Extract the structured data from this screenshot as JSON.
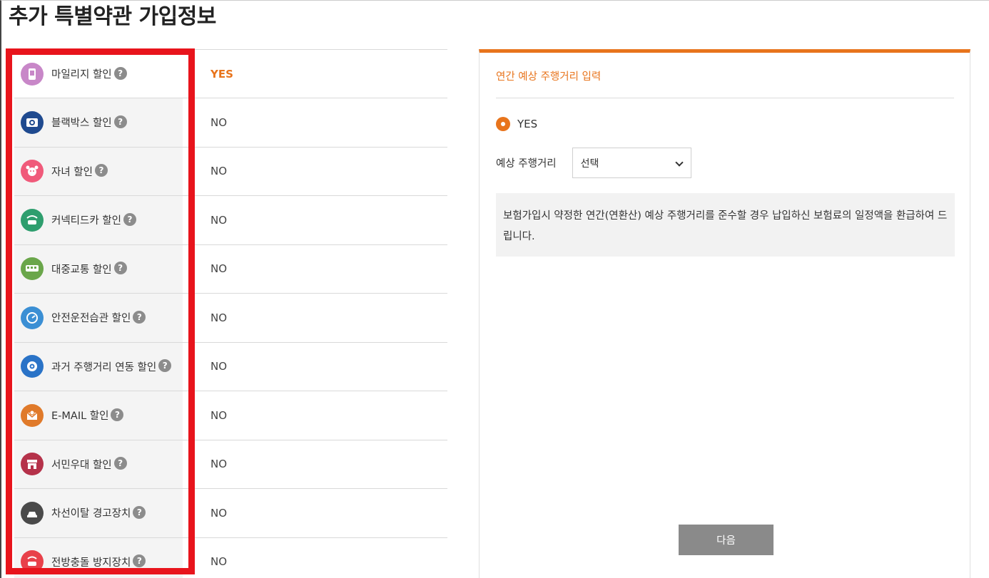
{
  "page": {
    "title": "추가 특별약관 가입정보"
  },
  "discounts": [
    {
      "name": "mileage",
      "label": "마일리지 할인",
      "value": "YES",
      "icon": "mileage-phone-icon",
      "color": "#c887c8"
    },
    {
      "name": "blackbox",
      "label": "블랙박스 할인",
      "value": "NO",
      "icon": "blackbox-camera-icon",
      "color": "#1f4a8f"
    },
    {
      "name": "child",
      "label": "자녀 할인",
      "value": "NO",
      "icon": "child-face-icon",
      "color": "#f05a7a"
    },
    {
      "name": "connected-car",
      "label": "커넥티드카 할인",
      "value": "NO",
      "icon": "connected-car-icon",
      "color": "#2e9e6e"
    },
    {
      "name": "public-transit",
      "label": "대중교통 할인",
      "value": "NO",
      "icon": "bus-icon",
      "color": "#6aa64a"
    },
    {
      "name": "safe-driving",
      "label": "안전운전습관 할인",
      "value": "NO",
      "icon": "speedometer-icon",
      "color": "#3b8fd4"
    },
    {
      "name": "past-mileage",
      "label": "과거 주행거리 연동 할인",
      "value": "NO",
      "icon": "odometer-icon",
      "color": "#2a73c7"
    },
    {
      "name": "email",
      "label": "E-MAIL 할인",
      "value": "NO",
      "icon": "envelope-icon",
      "color": "#e07a2a"
    },
    {
      "name": "low-income",
      "label": "서민우대 할인",
      "value": "NO",
      "icon": "store-icon",
      "color": "#b5324a"
    },
    {
      "name": "lane-warning",
      "label": "차선이탈 경고장치",
      "value": "NO",
      "icon": "car-lane-icon",
      "color": "#4a4a4a"
    },
    {
      "name": "collision",
      "label": "전방충돌 방지장치",
      "value": "NO",
      "icon": "car-collision-icon",
      "color": "#e8414a"
    }
  ],
  "help_symbol": "?",
  "panel": {
    "title": "연간 예상 주행거리 입력",
    "radio_label": "YES",
    "select_label": "예상 주행거리",
    "select_value": "선택",
    "notice": "보험가입시 약정한 연간(연환산) 예상 주행거리를 준수할 경우 납입하신 보험료의 일정액을 환급하여 드립니다.",
    "next_label": "다음"
  },
  "colors": {
    "accent": "#e8741c",
    "highlight": "#e8141c",
    "button": "#8a8a8a"
  }
}
